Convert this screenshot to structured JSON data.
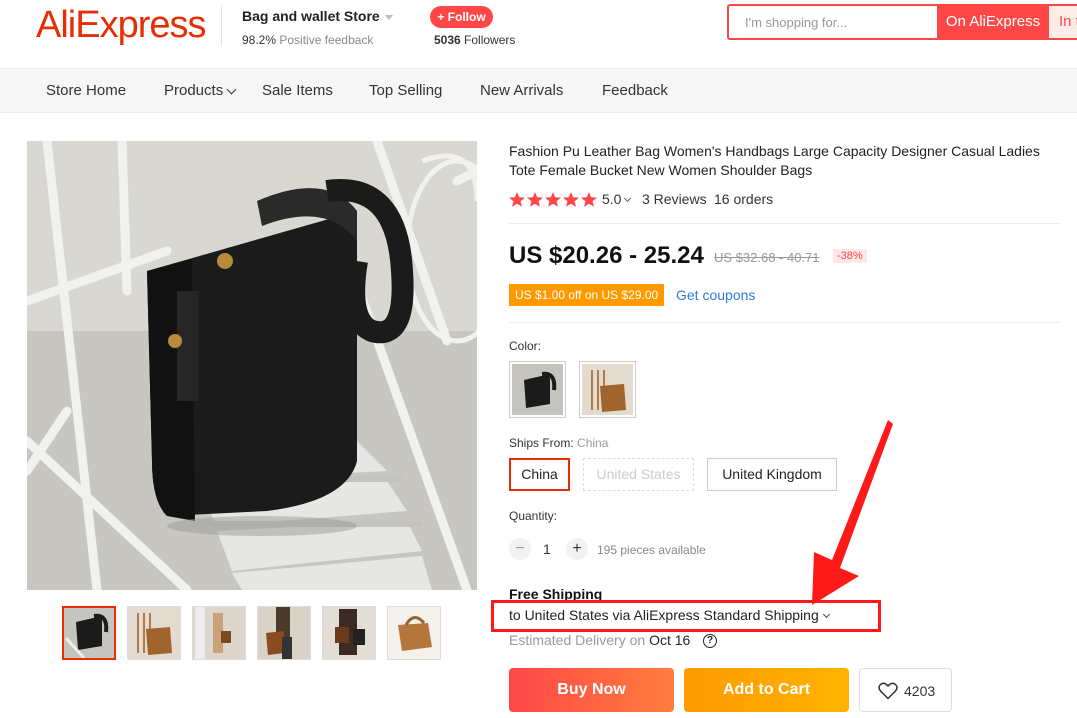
{
  "header": {
    "logo": "AliExpress",
    "store_name": "Bag and wallet Store",
    "feedback_pct": "98.2%",
    "feedback_label": "Positive feedback",
    "follow_label": "+ Follow",
    "followers_count": "5036",
    "followers_label": "Followers",
    "search_placeholder": "I'm shopping for...",
    "search_button": "On AliExpress",
    "search_button2": "In t"
  },
  "nav": {
    "items": [
      "Store Home",
      "Products",
      "Sale Items",
      "Top Selling",
      "New Arrivals",
      "Feedback"
    ]
  },
  "product": {
    "title": "Fashion Pu Leather Bag Women's Handbags Large Capacity Designer Casual Ladies Tote Female Bucket New Women Shoulder Bags",
    "rating": "5.0",
    "reviews": "3 Reviews",
    "orders": "16 orders",
    "price": "US $20.26 - 25.24",
    "original_price": "US $32.68 - 40.71",
    "discount": "-38%",
    "coupon": "US $1.00 off on US $29.00",
    "get_coupons": "Get coupons",
    "color_label": "Color:",
    "ships_from_label": "Ships From:",
    "ships_from_value": "China",
    "ship_options": [
      "China",
      "United States",
      "United Kingdom"
    ],
    "quantity_label": "Quantity:",
    "quantity_value": "1",
    "quantity_minus": "−",
    "quantity_plus": "+",
    "available": "195 pieces available",
    "free_shipping": "Free Shipping",
    "shipping_line": "to United States via AliExpress Standard Shipping",
    "est_delivery_label": "Estimated Delivery on",
    "est_delivery_date": "Oct 16",
    "help_glyph": "?",
    "buy_now": "Buy Now",
    "add_to_cart": "Add to Cart",
    "wishlist_count": "4203"
  },
  "colors": {
    "brand_red": "#e62e04",
    "button_red": "#ff4747",
    "cart_orange": "#ff9a00",
    "coupon_orange": "#ff9900",
    "link_blue": "#2e7bd6",
    "annotation_red": "#ff1a1a"
  },
  "icons": {
    "star": "star-icon",
    "heart": "heart-icon",
    "help": "help-circle-icon"
  }
}
